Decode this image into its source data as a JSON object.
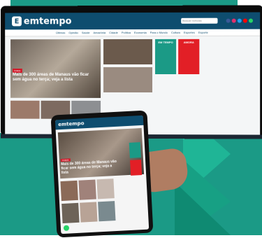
{
  "brand": {
    "logo_text": "emtempo",
    "logo_mark": "E",
    "search_placeholder": "Buscar notícias",
    "colors": {
      "header": "#0e4d6f",
      "accent": "#1b9a86",
      "tag": "#d11a2a",
      "magazine": "#e21f26"
    }
  },
  "nav": {
    "items": [
      "Últimas",
      "Opinião",
      "Saúde",
      "Amazônia",
      "Cidade",
      "Política",
      "Economia",
      "Para o Mundo",
      "Cultura",
      "Esportes",
      "Esporte"
    ]
  },
  "desktop": {
    "hero_tag": "Cidade",
    "hero_title": "Mais de 300 áreas de Manaus vão ficar sem água no terça; veja a lista",
    "card_left": "EM TEMPO",
    "card_right": "AMORA"
  },
  "tablet": {
    "logo_text": "emtempo",
    "hero_tag": "Cidade",
    "hero_title": "Mais de 300 áreas de Manaus vão ficar sem água no terça; veja a lista"
  },
  "social_icons": [
    "facebook-icon",
    "instagram-icon",
    "twitter-icon",
    "youtube-icon",
    "whatsapp-icon"
  ]
}
